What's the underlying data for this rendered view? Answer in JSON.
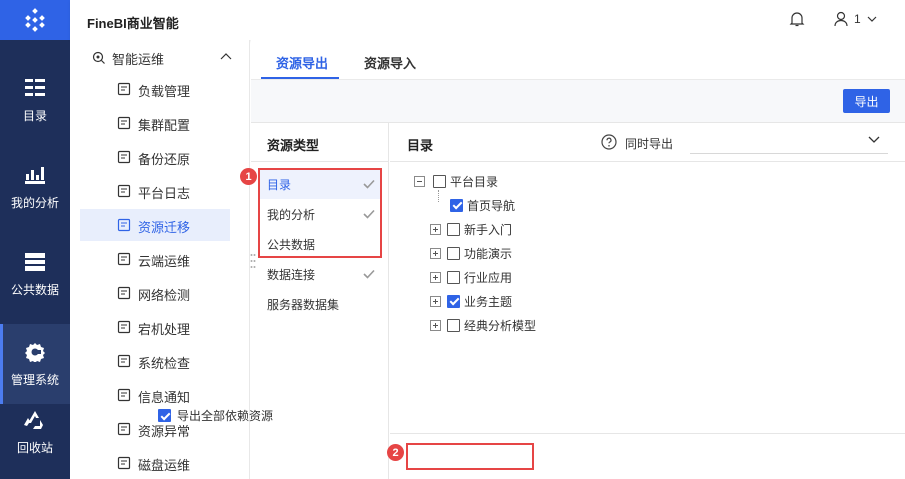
{
  "header": {
    "app_title": "FineBI商业智能",
    "user_label": "1"
  },
  "leftnav": {
    "items": [
      {
        "label": "目录",
        "icon": "catalog-icon"
      },
      {
        "label": "我的分析",
        "icon": "analysis-chart-icon"
      },
      {
        "label": "公共数据",
        "icon": "database-icon"
      },
      {
        "label": "管理系统",
        "icon": "gear-icon",
        "active": true
      },
      {
        "label": "回收站",
        "icon": "recycle-icon"
      }
    ]
  },
  "sidebar": {
    "parent_label": "智能运维",
    "items": [
      {
        "label": "负载管理"
      },
      {
        "label": "集群配置"
      },
      {
        "label": "备份还原"
      },
      {
        "label": "平台日志"
      },
      {
        "label": "资源迁移",
        "active": true
      },
      {
        "label": "云端运维"
      },
      {
        "label": "网络检测"
      },
      {
        "label": "宕机处理"
      },
      {
        "label": "系统检查"
      },
      {
        "label": "信息通知"
      },
      {
        "label": "资源异常"
      },
      {
        "label": "磁盘运维"
      }
    ]
  },
  "tabs": {
    "export": "资源导出",
    "import": "资源导入"
  },
  "toolbar": {
    "export_button": "导出"
  },
  "resource_types": {
    "header": "资源类型",
    "items": [
      {
        "label": "目录",
        "checked": true,
        "active": true
      },
      {
        "label": "我的分析",
        "checked": true
      },
      {
        "label": "公共数据",
        "checked": false
      },
      {
        "label": "数据连接",
        "checked": true
      },
      {
        "label": "服务器数据集",
        "checked": false
      }
    ]
  },
  "catalog_panel": {
    "header": "目录",
    "sync_export_label": "同时导出",
    "tree_root": "平台目录",
    "tree_children": [
      {
        "label": "首页导航",
        "checked": true
      },
      {
        "label": "新手入门",
        "checked": false
      },
      {
        "label": "功能演示",
        "checked": false
      },
      {
        "label": "行业应用",
        "checked": false
      },
      {
        "label": "业务主题",
        "checked": true
      },
      {
        "label": "经典分析模型",
        "checked": false
      }
    ]
  },
  "footer": {
    "export_all_deps": "导出全部依赖资源",
    "export_all_checked": true
  },
  "annotations": {
    "badge1": "1",
    "badge2": "2"
  },
  "colors": {
    "brand": "#2f63e6",
    "nav_bg": "#1e2f5a",
    "highlight": "#e64545"
  }
}
